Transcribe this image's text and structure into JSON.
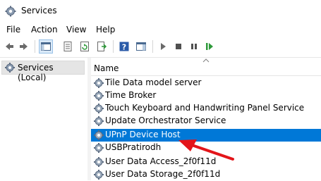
{
  "window": {
    "title": "Services"
  },
  "menu": [
    "File",
    "Action",
    "View",
    "Help"
  ],
  "toolbar": {
    "icons": [
      "back-icon",
      "forward-icon",
      "show-hide-console-tree-icon",
      "properties-icon",
      "refresh-icon",
      "export-list-icon",
      "help-icon",
      "show-hide-action-pane-icon",
      "start-service-icon",
      "stop-service-icon",
      "pause-service-icon",
      "restart-service-icon"
    ]
  },
  "tree": {
    "root": "Services (Local)"
  },
  "list": {
    "column": "Name",
    "rows": [
      "Tile Data model server",
      "Time Broker",
      "Touch Keyboard and Handwriting Panel Service",
      "Update Orchestrator Service",
      "UPnP Device Host",
      "USBPratirodh",
      "User Data Access_2f0f11d",
      "User Data Storage_2f0f11d"
    ],
    "selected_index": 4
  },
  "colors": {
    "selection": "#0078d7",
    "annotation_arrow": "#e3151a"
  }
}
